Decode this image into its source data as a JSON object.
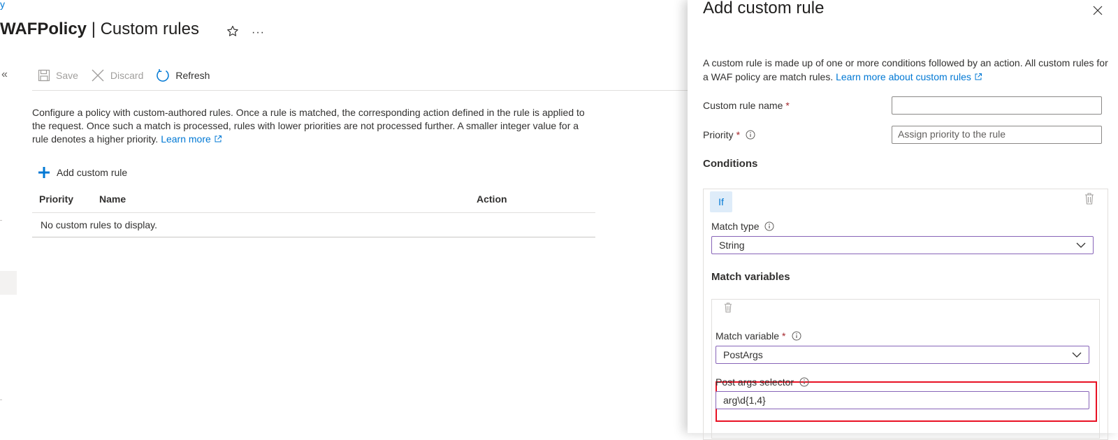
{
  "breadcrumb": "y",
  "page": {
    "title_bold": "WAFPolicy",
    "title_rest": " | Custom rules",
    "more": "···"
  },
  "toolbar": {
    "collapse": "«",
    "save": "Save",
    "discard": "Discard",
    "refresh": "Refresh"
  },
  "description": {
    "text": "Configure a policy with custom-authored rules. Once a rule is matched, the corresponding action defined in the rule is applied to the request. Once such a match is processed, rules with lower priorities are not processed further. A smaller integer value for a rule denotes a higher priority.",
    "link": "Learn more"
  },
  "add_rule_label": "Add custom rule",
  "table": {
    "columns": [
      "Priority",
      "Name",
      "Action"
    ],
    "empty_text": "No custom rules to display."
  },
  "panel": {
    "title": "Add custom rule",
    "description": "A custom rule is made up of one or more conditions followed by an action. All custom rules for a WAF policy are match rules.",
    "description_link": "Learn more about custom rules",
    "name_label": "Custom rule name",
    "name_value": "",
    "priority_label": "Priority",
    "priority_placeholder": "Assign priority to the rule",
    "conditions_heading": "Conditions",
    "if_label": "If",
    "match_type_label": "Match type",
    "match_type_value": "String",
    "match_variables_heading": "Match variables",
    "match_variable_label": "Match variable",
    "match_variable_value": "PostArgs",
    "post_args_label": "Post args selector",
    "post_args_value": "arg\\d{1,4}"
  },
  "colors": {
    "accent": "#0078d4",
    "required": "#a4262c",
    "highlight": "#e81123",
    "select_border": "#8764b8"
  }
}
